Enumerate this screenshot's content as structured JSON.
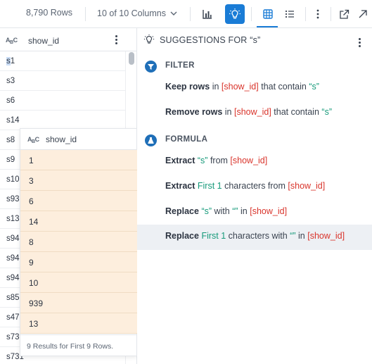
{
  "toolbar": {
    "rows_label": "8,790 Rows",
    "columns_label": "10 of 10 Columns",
    "icons": [
      "chart-icon",
      "lightbulb-icon",
      "grid-view-icon",
      "list-view-icon",
      "more-icon",
      "open-external-icon",
      "collapse-icon"
    ],
    "accent_color": "#1a7cd6"
  },
  "grid": {
    "type_badge": "ABC",
    "column_title": "show_id",
    "cells": [
      "s1",
      "s3",
      "s6",
      "s14",
      "s8",
      "s9",
      "s10",
      "s93",
      "s13",
      "s94",
      "s94",
      "s94",
      "s85",
      "s47",
      "s73",
      "s731"
    ]
  },
  "popover": {
    "type_badge": "ABC",
    "column_title": "show_id",
    "values": [
      "1",
      "3",
      "6",
      "14",
      "8",
      "9",
      "10",
      "939",
      "13"
    ],
    "footer": "9 Results for First 9 Rows."
  },
  "panel": {
    "title": "SUGGESTIONS FOR “s”",
    "filter_section": "FILTER",
    "formula_section": "FORMULA",
    "suggestions": {
      "keep": {
        "action": "Keep rows",
        "t1": "in",
        "col": "[show_id]",
        "t2": "that contain",
        "lit": "“s”"
      },
      "remove": {
        "action": "Remove rows",
        "t1": "in",
        "col": "[show_id]",
        "t2": "that contain",
        "lit": "“s”"
      },
      "extract1": {
        "action": "Extract",
        "lit": "“s”",
        "t1": "from",
        "col": "[show_id]"
      },
      "extract2": {
        "action": "Extract",
        "lit": "First 1",
        "t1": "characters from",
        "col": "[show_id]"
      },
      "replace1": {
        "action": "Replace",
        "lit": "“s”",
        "t1": "with",
        "lit2": "“”",
        "t2": "in",
        "col": "[show_id]"
      },
      "replace2": {
        "action": "Replace",
        "lit": "First 1",
        "t1": "characters with",
        "lit2": "“”",
        "t2": "in",
        "col": "[show_id]"
      }
    },
    "colors": {
      "column_ref": "#d9342b",
      "literal": "#169a7a"
    }
  }
}
